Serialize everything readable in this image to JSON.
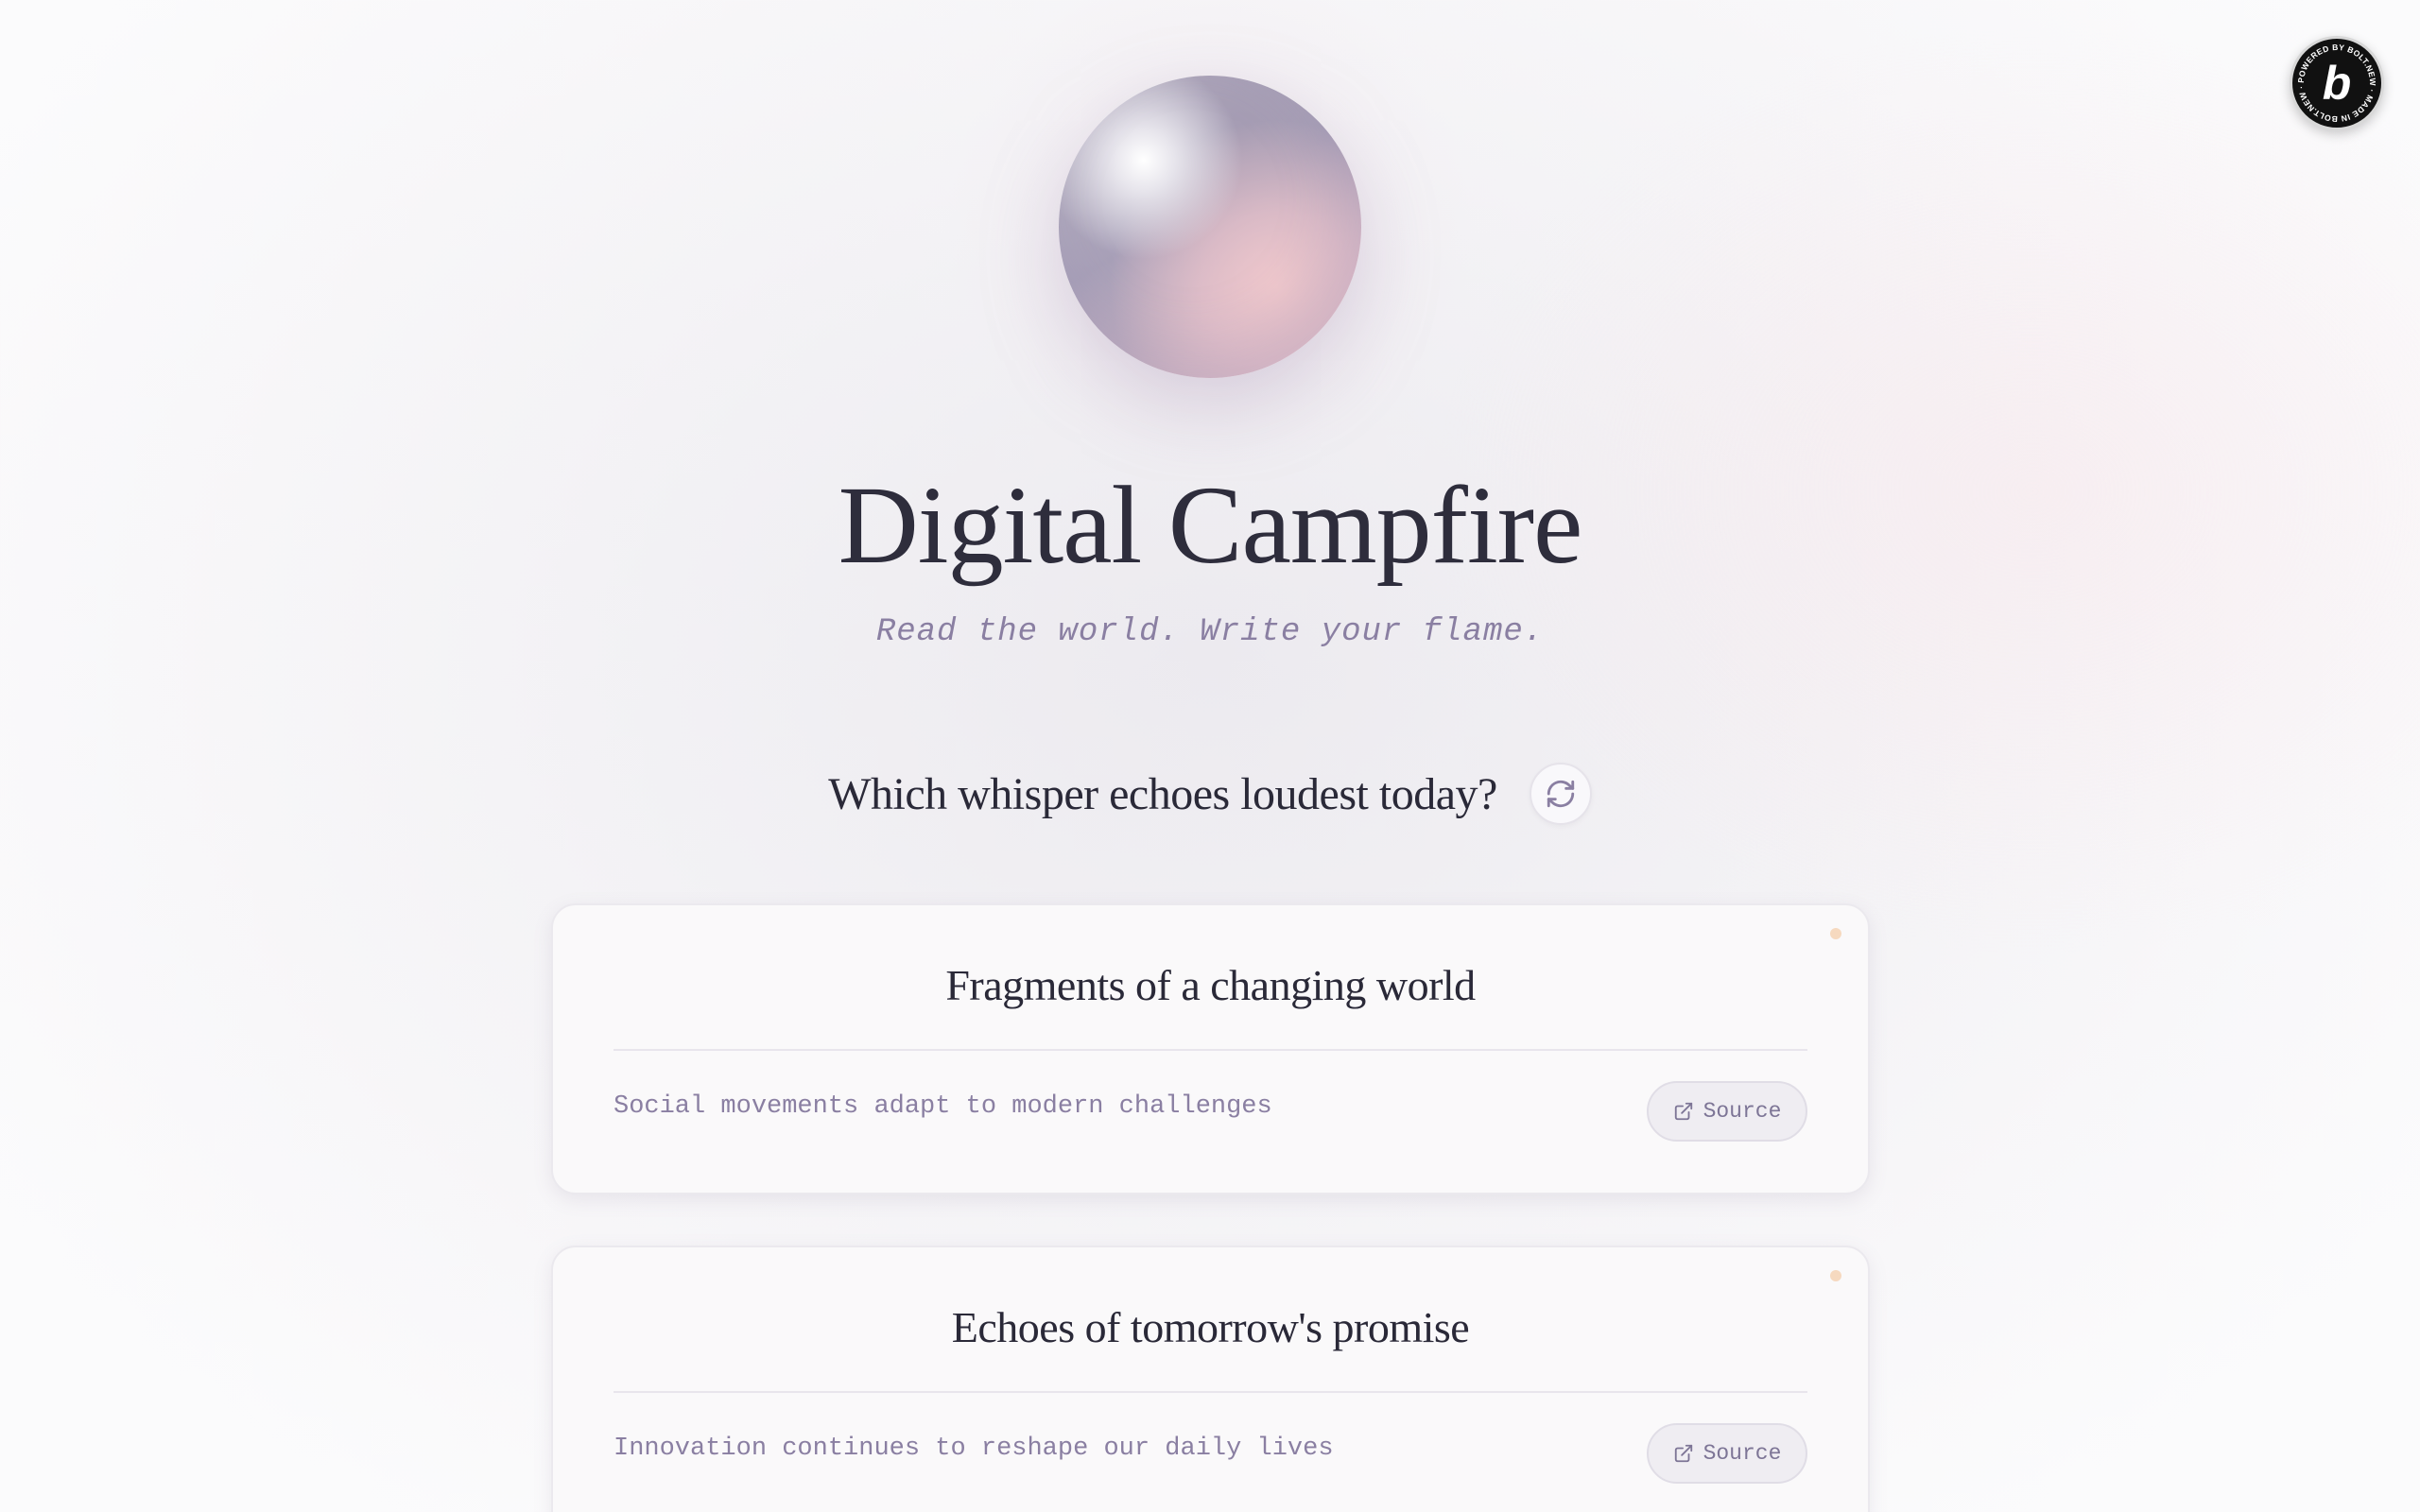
{
  "badge": {
    "text": "POWERED BY BOLT.NEW · MADE IN BOLT.NEW ·",
    "letter": "b",
    "icon": "bolt-logo-icon"
  },
  "header": {
    "title": "Digital Campfire",
    "subtitle": "Read the world. Write your flame."
  },
  "question": {
    "text": "Which whisper echoes loudest today?",
    "refresh_icon": "refresh-icon"
  },
  "cards": [
    {
      "title": "Fragments of a changing world",
      "text": "Social movements adapt to modern challenges",
      "source_label": "Source",
      "source_icon": "external-link-icon"
    },
    {
      "title": "Echoes of tomorrow's promise",
      "text": "Innovation continues to reshape our daily lives",
      "source_label": "Source",
      "source_icon": "external-link-icon"
    }
  ],
  "colors": {
    "accent_text": "#8a7fa2",
    "title_text": "#2e2d3c",
    "card_dot": "#f6d9bf",
    "badge_bg": "#111111"
  }
}
